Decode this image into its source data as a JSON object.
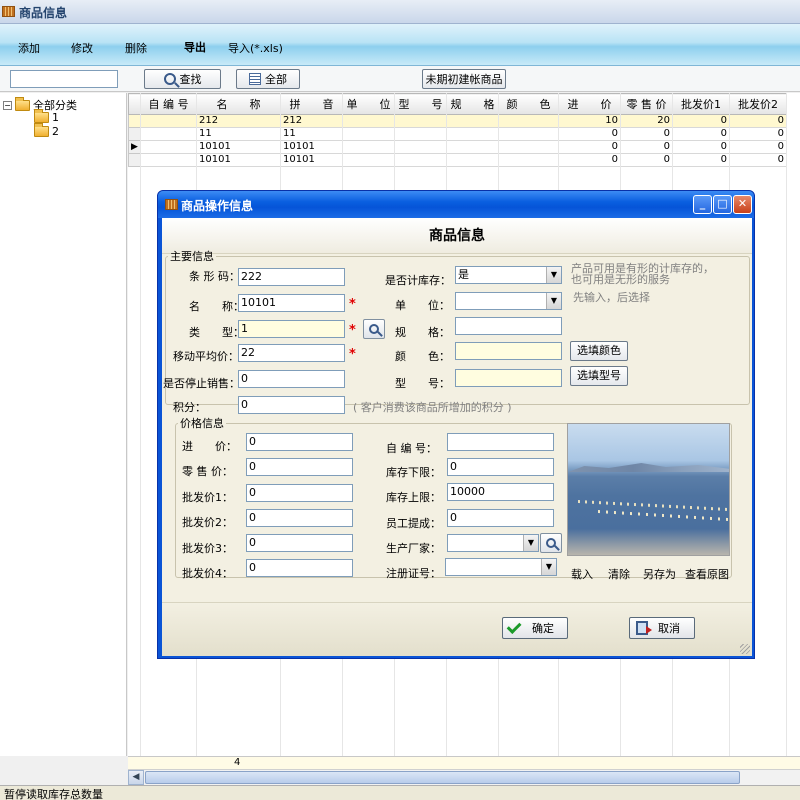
{
  "window": {
    "title": "商品信息"
  },
  "toolbar": {
    "add": "添加",
    "edit": "修改",
    "delete": "删除",
    "export": "导出",
    "import": "导入(*.xls)"
  },
  "search": {
    "value": "",
    "find_label": "查找",
    "all_label": "全部",
    "unsettled_label": "未期初建帐商品"
  },
  "tree": {
    "root": "全部分类",
    "children": [
      "1",
      "2"
    ]
  },
  "grid": {
    "columns": [
      "自 编 号",
      "名　　称",
      "拼　　音",
      "单　　位",
      "型　　号",
      "规　　格",
      "颜　　色",
      "进　　价",
      "零 售 价",
      "批发价1",
      "批发价2"
    ],
    "rows": [
      {
        "code": "",
        "name": "212",
        "pinyin": "212",
        "unit": "",
        "model": "",
        "spec": "",
        "color": "",
        "cost": "10",
        "retail": "20",
        "w1": "0",
        "w2": "0"
      },
      {
        "code": "",
        "name": "11",
        "pinyin": "11",
        "unit": "",
        "model": "",
        "spec": "",
        "color": "",
        "cost": "0",
        "retail": "0",
        "w1": "0",
        "w2": "0"
      },
      {
        "code": "",
        "name": "10101",
        "pinyin": "10101",
        "unit": "",
        "model": "",
        "spec": "",
        "color": "",
        "cost": "0",
        "retail": "0",
        "w1": "0",
        "w2": "0"
      },
      {
        "code": "",
        "name": "10101",
        "pinyin": "10101",
        "unit": "",
        "model": "",
        "spec": "",
        "color": "",
        "cost": "0",
        "retail": "0",
        "w1": "0",
        "w2": "0"
      }
    ],
    "footer_count": "4"
  },
  "status": {
    "text": "暂停读取库存总数量"
  },
  "dialog": {
    "title": "商品操作信息",
    "heading": "商品信息",
    "main_group": "主要信息",
    "barcode_label": "条 形 码：",
    "barcode": "222",
    "name_label": "名　　称：",
    "name": "10101",
    "type_label": "类　　型：",
    "type": "1",
    "avg_price_label": "移动平均价：",
    "avg_price": "22",
    "stop_sale_label": "是否停止销售：",
    "stop_sale": "0",
    "points_label": "积分：",
    "points": "0",
    "points_hint": "( 客户消费该商品所增加的积分 )",
    "stock_label": "是否计库存：",
    "stock": "是",
    "stock_hint1": "产品可用是有形的计库存的，",
    "stock_hint2": "也可用是无形的服务",
    "unit_label": "单　　位：",
    "unit": "",
    "unit_hint": "先输入，后选择",
    "spec_label": "规　　格：",
    "spec": "",
    "color_label": "颜　　色：",
    "color": "",
    "color_btn": "选填颜色",
    "model_label": "型　　号：",
    "model": "",
    "model_btn": "选填型号",
    "price_group": "价格信息",
    "cost_label": "进　　价：",
    "cost": "0",
    "retail_label": "零 售 价：",
    "retail": "0",
    "w1_label": "批发价1：",
    "w1": "0",
    "w2_label": "批发价2：",
    "w2": "0",
    "w3_label": "批发价3：",
    "w3": "0",
    "w4_label": "批发价4：",
    "w4": "0",
    "code_label": "自 编 号：",
    "code": "",
    "min_stock_label": "库存下限：",
    "min_stock": "0",
    "max_stock_label": "库存上限：",
    "max_stock": "10000",
    "commission_label": "员工提成：",
    "commission": "0",
    "maker_label": "生产厂家：",
    "maker": "",
    "reg_label": "注册证号：",
    "reg": "",
    "load": "载入",
    "clear": "清除",
    "save_as": "另存为",
    "view_original": "查看原图",
    "ok": "确定",
    "cancel": "取消"
  }
}
